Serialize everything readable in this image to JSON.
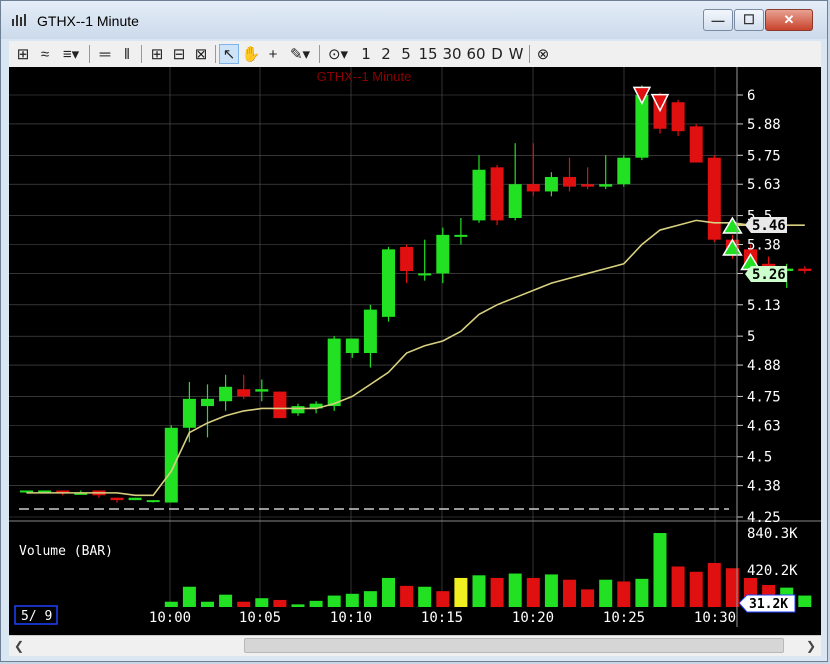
{
  "window": {
    "title": "GTHX--1 Minute",
    "minimize": "—",
    "maximize": "☐",
    "close": "✕"
  },
  "toolbar": {
    "timeframes": [
      "1",
      "2",
      "5",
      "15",
      "30",
      "60",
      "D",
      "W"
    ]
  },
  "chart": {
    "watermark": "GTHX--1 Minute",
    "volume_label": "Volume (BAR)",
    "date_label": "5/ 9",
    "price_badge_high": "5.46",
    "price_badge_low": "5.26",
    "volume_badge": "31.2K"
  },
  "chart_data": [
    {
      "type": "candlestick",
      "title": "GTHX--1 Minute",
      "x_ticks": [
        "10:00",
        "10:05",
        "10:10",
        "10:15",
        "10:20",
        "10:25",
        "10:30"
      ],
      "y_ticks": [
        "6",
        "5.88",
        "5.75",
        "5.63",
        "5.5",
        "5.38",
        "5.26",
        "5.13",
        "5",
        "4.88",
        "4.75",
        "4.63",
        "4.5",
        "4.38",
        "4.25"
      ],
      "ylim": [
        4.25,
        6.05
      ],
      "candles": [
        {
          "o": 4.36,
          "h": 4.36,
          "l": 4.35,
          "c": 4.36,
          "color": "green"
        },
        {
          "o": 4.36,
          "h": 4.36,
          "l": 4.35,
          "c": 4.36,
          "color": "green"
        },
        {
          "o": 4.36,
          "h": 4.36,
          "l": 4.34,
          "c": 4.35,
          "color": "red"
        },
        {
          "o": 4.35,
          "h": 4.36,
          "l": 4.35,
          "c": 4.35,
          "color": "green"
        },
        {
          "o": 4.36,
          "h": 4.36,
          "l": 4.33,
          "c": 4.34,
          "color": "red"
        },
        {
          "o": 4.33,
          "h": 4.33,
          "l": 4.31,
          "c": 4.32,
          "color": "red"
        },
        {
          "o": 4.32,
          "h": 4.33,
          "l": 4.32,
          "c": 4.33,
          "color": "green"
        },
        {
          "o": 4.32,
          "h": 4.32,
          "l": 4.31,
          "c": 4.32,
          "color": "green"
        },
        {
          "o": 4.31,
          "h": 4.63,
          "l": 4.31,
          "c": 4.62,
          "color": "green"
        },
        {
          "o": 4.62,
          "h": 4.81,
          "l": 4.56,
          "c": 4.74,
          "color": "green"
        },
        {
          "o": 4.71,
          "h": 4.8,
          "l": 4.58,
          "c": 4.74,
          "color": "green"
        },
        {
          "o": 4.73,
          "h": 4.84,
          "l": 4.69,
          "c": 4.79,
          "color": "green"
        },
        {
          "o": 4.78,
          "h": 4.84,
          "l": 4.74,
          "c": 4.75,
          "color": "red"
        },
        {
          "o": 4.78,
          "h": 4.82,
          "l": 4.73,
          "c": 4.77,
          "color": "green"
        },
        {
          "o": 4.77,
          "h": 4.77,
          "l": 4.66,
          "c": 4.66,
          "color": "red"
        },
        {
          "o": 4.68,
          "h": 4.72,
          "l": 4.67,
          "c": 4.71,
          "color": "green"
        },
        {
          "o": 4.7,
          "h": 4.73,
          "l": 4.68,
          "c": 4.72,
          "color": "green"
        },
        {
          "o": 4.71,
          "h": 5.0,
          "l": 4.69,
          "c": 4.99,
          "color": "green"
        },
        {
          "o": 4.93,
          "h": 4.99,
          "l": 4.91,
          "c": 4.99,
          "color": "green"
        },
        {
          "o": 4.93,
          "h": 5.13,
          "l": 4.87,
          "c": 5.11,
          "color": "green"
        },
        {
          "o": 5.08,
          "h": 5.37,
          "l": 5.06,
          "c": 5.36,
          "color": "green"
        },
        {
          "o": 5.37,
          "h": 5.38,
          "l": 5.22,
          "c": 5.27,
          "color": "red"
        },
        {
          "o": 5.26,
          "h": 5.4,
          "l": 5.23,
          "c": 5.26,
          "color": "green"
        },
        {
          "o": 5.26,
          "h": 5.45,
          "l": 5.22,
          "c": 5.42,
          "color": "green"
        },
        {
          "o": 5.42,
          "h": 5.49,
          "l": 5.38,
          "c": 5.42,
          "color": "green"
        },
        {
          "o": 5.48,
          "h": 5.75,
          "l": 5.47,
          "c": 5.69,
          "color": "green"
        },
        {
          "o": 5.7,
          "h": 5.71,
          "l": 5.46,
          "c": 5.48,
          "color": "red"
        },
        {
          "o": 5.49,
          "h": 5.8,
          "l": 5.48,
          "c": 5.63,
          "color": "green"
        },
        {
          "o": 5.63,
          "h": 5.8,
          "l": 5.58,
          "c": 5.6,
          "color": "red"
        },
        {
          "o": 5.6,
          "h": 5.68,
          "l": 5.58,
          "c": 5.66,
          "color": "green"
        },
        {
          "o": 5.66,
          "h": 5.74,
          "l": 5.6,
          "c": 5.62,
          "color": "red"
        },
        {
          "o": 5.63,
          "h": 5.7,
          "l": 5.61,
          "c": 5.62,
          "color": "red"
        },
        {
          "o": 5.62,
          "h": 5.75,
          "l": 5.61,
          "c": 5.63,
          "color": "green"
        },
        {
          "o": 5.63,
          "h": 5.75,
          "l": 5.62,
          "c": 5.74,
          "color": "green"
        },
        {
          "o": 5.74,
          "h": 6.04,
          "l": 5.73,
          "c": 6.0,
          "color": "green"
        },
        {
          "o": 5.99,
          "h": 6.01,
          "l": 5.84,
          "c": 5.86,
          "color": "red"
        },
        {
          "o": 5.97,
          "h": 5.98,
          "l": 5.83,
          "c": 5.85,
          "color": "red"
        },
        {
          "o": 5.87,
          "h": 5.88,
          "l": 5.72,
          "c": 5.72,
          "color": "red"
        },
        {
          "o": 5.74,
          "h": 5.75,
          "l": 5.39,
          "c": 5.4,
          "color": "red"
        },
        {
          "o": 5.4,
          "h": 5.42,
          "l": 5.32,
          "c": 5.34,
          "color": "red"
        },
        {
          "o": 5.36,
          "h": 5.38,
          "l": 5.26,
          "c": 5.3,
          "color": "red"
        },
        {
          "o": 5.3,
          "h": 5.33,
          "l": 5.23,
          "c": 5.27,
          "color": "red"
        },
        {
          "o": 5.27,
          "h": 5.3,
          "l": 5.2,
          "c": 5.28,
          "color": "green"
        },
        {
          "o": 5.28,
          "h": 5.29,
          "l": 5.26,
          "c": 5.27,
          "color": "red"
        }
      ],
      "moving_average": [
        4.35,
        4.35,
        4.35,
        4.35,
        4.35,
        4.35,
        4.34,
        4.34,
        4.44,
        4.6,
        4.64,
        4.67,
        4.69,
        4.7,
        4.7,
        4.7,
        4.7,
        4.72,
        4.75,
        4.8,
        4.85,
        4.93,
        4.96,
        4.98,
        5.02,
        5.09,
        5.13,
        5.16,
        5.19,
        5.22,
        5.24,
        5.26,
        5.28,
        5.3,
        5.38,
        5.44,
        5.46,
        5.48,
        5.47,
        5.47,
        5.46,
        5.46,
        5.46,
        5.46
      ],
      "signals": [
        {
          "bar": 34,
          "type": "sell"
        },
        {
          "bar": 35,
          "type": "sell"
        },
        {
          "bar": 39,
          "type": "buy"
        },
        {
          "bar": 39,
          "type": "buy"
        },
        {
          "bar": 40,
          "type": "buy"
        }
      ]
    },
    {
      "type": "bar",
      "title": "Volume (BAR)",
      "y_ticks": [
        "840.3K",
        "420.2K"
      ],
      "ylim": [
        0,
        840.3
      ],
      "unit": "K",
      "values": [
        0,
        0,
        0,
        0,
        0,
        0,
        0,
        0,
        60,
        230,
        60,
        140,
        60,
        100,
        80,
        30,
        70,
        130,
        150,
        180,
        330,
        240,
        230,
        180,
        330,
        360,
        330,
        380,
        330,
        370,
        310,
        200,
        310,
        290,
        320,
        840,
        460,
        400,
        500,
        440,
        330,
        250,
        220,
        130
      ],
      "colors": [
        "green",
        "green",
        "green",
        "green",
        "green",
        "green",
        "green",
        "green",
        "green",
        "green",
        "green",
        "green",
        "red",
        "green",
        "red",
        "green",
        "green",
        "green",
        "green",
        "green",
        "green",
        "red",
        "green",
        "red",
        "yellow",
        "green",
        "red",
        "green",
        "red",
        "green",
        "red",
        "red",
        "green",
        "red",
        "green",
        "green",
        "red",
        "red",
        "red",
        "red",
        "red",
        "red",
        "green",
        "green"
      ]
    }
  ],
  "colors": {
    "up": "#22e022",
    "down": "#e01010",
    "ma": "#d8d080",
    "grid": "#555555",
    "axis_text": "#ffffff",
    "volume_yellow": "#f0f020"
  }
}
